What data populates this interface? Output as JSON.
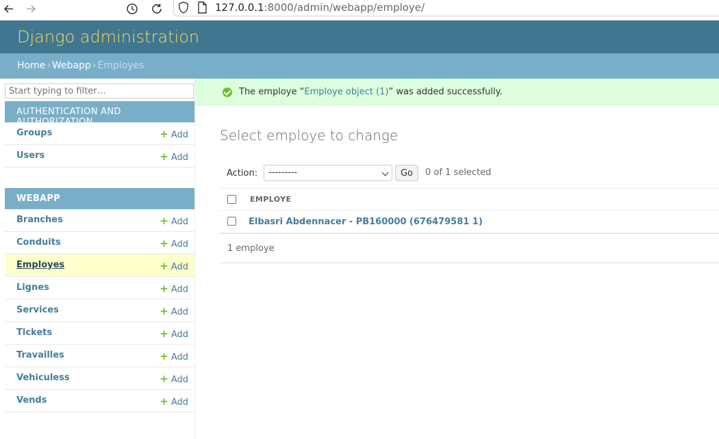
{
  "browser": {
    "url_host": "127.0.0.1",
    "url_path": ":8000/admin/webapp/employe/"
  },
  "header": {
    "branding": "Django administration"
  },
  "breadcrumbs": {
    "home": "Home",
    "app": "Webapp",
    "current": "Employes",
    "separator": "›"
  },
  "sidebar": {
    "filter_placeholder": "Start typing to filter…",
    "add_label": "Add",
    "modules": [
      {
        "caption": "AUTHENTICATION AND AUTHORIZATION",
        "items": [
          "Groups",
          "Users"
        ]
      },
      {
        "caption": "WEBAPP",
        "items": [
          "Branches",
          "Conduits",
          "Employes",
          "Lignes",
          "Services",
          "Tickets",
          "Travailles",
          "Vehiculess",
          "Vends"
        ]
      }
    ],
    "current_item": "Employes"
  },
  "message": {
    "prefix": "The employe “",
    "link": "Employe object (1)",
    "suffix": "” was added successfully."
  },
  "main": {
    "title": "Select employe to change",
    "action_label": "Action:",
    "action_value": "---------",
    "go_label": "Go",
    "selected_count": "0 of 1 selected",
    "column_header": "EMPLOYE",
    "rows": [
      "Elbasri Abdennacer - PB160000 (676479581 1)"
    ],
    "paginator": "1 employe"
  }
}
